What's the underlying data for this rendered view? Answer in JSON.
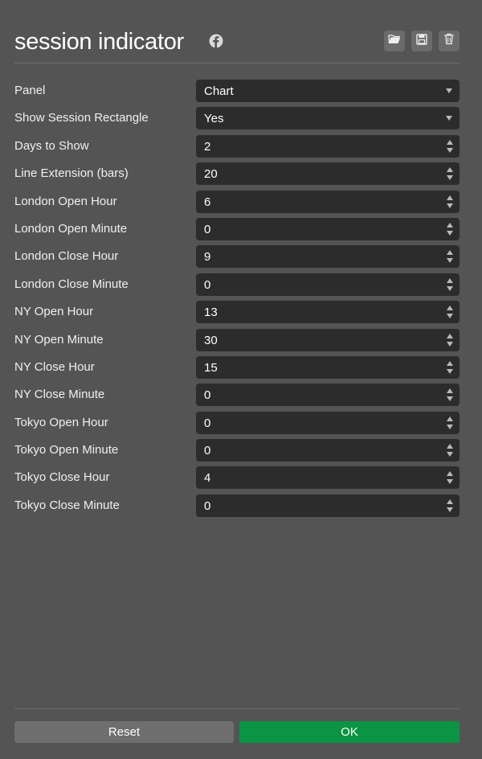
{
  "header": {
    "title": "session indicator",
    "icons": [
      "facebook-icon",
      "open-folder-icon",
      "save-icon",
      "trash-icon"
    ]
  },
  "fields": [
    {
      "label": "Panel",
      "value": "Chart",
      "control": "select"
    },
    {
      "label": "Show Session Rectangle",
      "value": "Yes",
      "control": "select"
    },
    {
      "label": "Days to Show",
      "value": "2",
      "control": "number"
    },
    {
      "label": "Line Extension (bars)",
      "value": "20",
      "control": "number"
    },
    {
      "label": "London Open Hour",
      "value": "6",
      "control": "number"
    },
    {
      "label": "London Open Minute",
      "value": "0",
      "control": "number"
    },
    {
      "label": "London Close Hour",
      "value": "9",
      "control": "number"
    },
    {
      "label": "London Close Minute",
      "value": "0",
      "control": "number"
    },
    {
      "label": "NY Open Hour",
      "value": "13",
      "control": "number"
    },
    {
      "label": "NY Open Minute",
      "value": "30",
      "control": "number"
    },
    {
      "label": "NY Close Hour",
      "value": "15",
      "control": "number"
    },
    {
      "label": "NY Close Minute",
      "value": "0",
      "control": "number"
    },
    {
      "label": "Tokyo Open Hour",
      "value": "0",
      "control": "number"
    },
    {
      "label": "Tokyo Open Minute",
      "value": "0",
      "control": "number"
    },
    {
      "label": "Tokyo Close Hour",
      "value": "4",
      "control": "number"
    },
    {
      "label": "Tokyo Close Minute",
      "value": "0",
      "control": "number"
    }
  ],
  "footer": {
    "reset_label": "Reset",
    "ok_label": "OK"
  },
  "colors": {
    "background": "#545454",
    "field_background": "#2c2c2c",
    "reset_button": "#6e6e6e",
    "ok_button": "#0a9443"
  }
}
